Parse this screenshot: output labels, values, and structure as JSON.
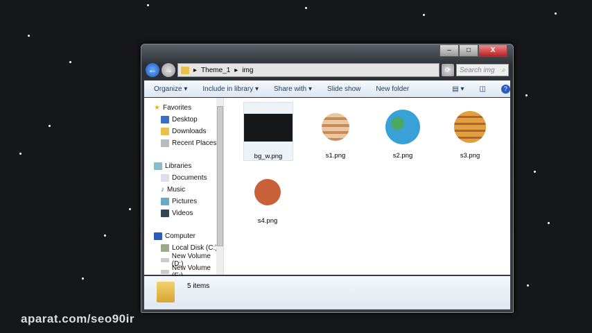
{
  "window": {
    "minimize": "–",
    "maximize": "□",
    "close": "X"
  },
  "address": {
    "path": [
      "Theme_1",
      "img"
    ],
    "search_placeholder": "Search img"
  },
  "toolbar": {
    "organize": "Organize ▾",
    "include": "Include in library ▾",
    "share": "Share with ▾",
    "slideshow": "Slide show",
    "new_folder": "New folder"
  },
  "nav": {
    "favorites": "Favorites",
    "desktop": "Desktop",
    "downloads": "Downloads",
    "recent": "Recent Places",
    "libraries": "Libraries",
    "documents": "Documents",
    "music": "Music",
    "pictures": "Pictures",
    "videos": "Videos",
    "computer": "Computer",
    "c": "Local Disk (C:)",
    "d": "New Volume (D:)",
    "e": "New Volume (E:)"
  },
  "files": [
    "bg_w.png",
    "s1.png",
    "s2.png",
    "s3.png",
    "s4.png"
  ],
  "status": {
    "count": "5 items"
  },
  "watermark": "aparat.com/seo90ir"
}
